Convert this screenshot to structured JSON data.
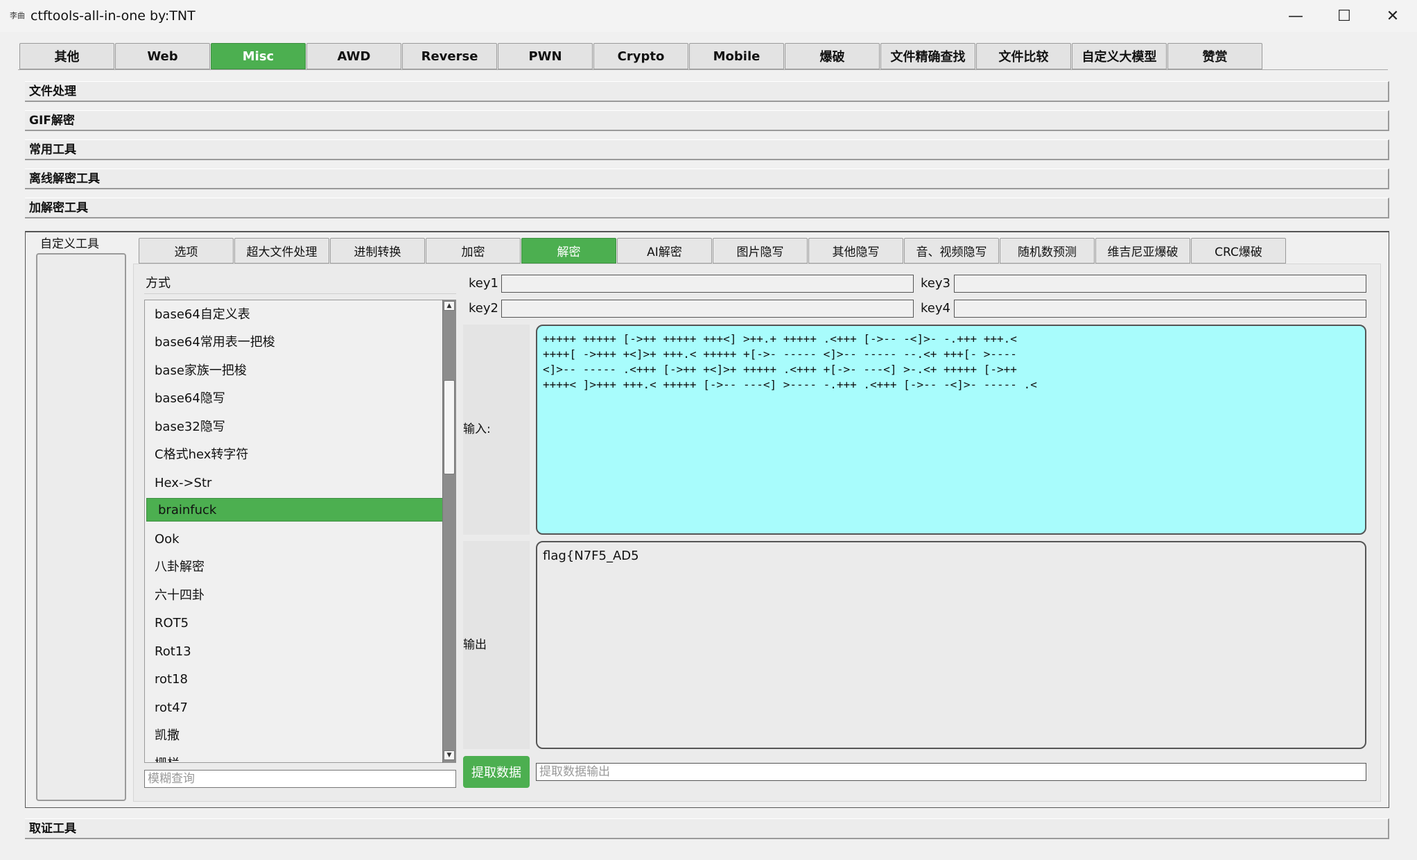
{
  "window": {
    "app_icon_text": "李曲",
    "title": "ctftools-all-in-one   by:TNT",
    "minimize": "—",
    "maximize": "☐",
    "close": "✕"
  },
  "top_tabs": [
    {
      "label": "其他",
      "active": false
    },
    {
      "label": "Web",
      "active": false
    },
    {
      "label": "Misc",
      "active": true
    },
    {
      "label": "AWD",
      "active": false
    },
    {
      "label": "Reverse",
      "active": false
    },
    {
      "label": "PWN",
      "active": false
    },
    {
      "label": "Crypto",
      "active": false
    },
    {
      "label": "Mobile",
      "active": false
    },
    {
      "label": "爆破",
      "active": false
    },
    {
      "label": "文件精确查找",
      "active": false
    },
    {
      "label": "文件比较",
      "active": false
    },
    {
      "label": "自定义大模型",
      "active": false
    },
    {
      "label": "赞赏",
      "active": false
    }
  ],
  "sections": [
    "文件处理",
    "GIF解密",
    "常用工具",
    "离线解密工具",
    "加解密工具"
  ],
  "bottom_section": "取证工具",
  "custom_tools_title": "自定义工具",
  "inner_tabs": [
    {
      "label": "选项",
      "active": false
    },
    {
      "label": "超大文件处理",
      "active": false
    },
    {
      "label": "进制转换",
      "active": false
    },
    {
      "label": "加密",
      "active": false
    },
    {
      "label": "解密",
      "active": true
    },
    {
      "label": "AI解密",
      "active": false
    },
    {
      "label": "图片隐写",
      "active": false
    },
    {
      "label": "其他隐写",
      "active": false
    },
    {
      "label": "音、视频隐写",
      "active": false
    },
    {
      "label": "随机数预测",
      "active": false
    },
    {
      "label": "维吉尼亚爆破",
      "active": false
    },
    {
      "label": "CRC爆破",
      "active": false
    }
  ],
  "method": {
    "label": "方式",
    "items": [
      "base64自定义表",
      "base64常用表一把梭",
      "base家族一把梭",
      "base64隐写",
      "base32隐写",
      "C格式hex转字符",
      "Hex->Str",
      "brainfuck",
      "Ook",
      "八卦解密",
      "六十四卦",
      "ROT5",
      "Rot13",
      "rot18",
      "rot47",
      "凯撒",
      "栅栏"
    ],
    "selected_index": 7,
    "search_placeholder": "模糊查询",
    "scroll_up": "▲",
    "scroll_down": "▼"
  },
  "keys": {
    "key1_label": "key1",
    "key1_value": "",
    "key2_label": "key2",
    "key2_value": "",
    "key3_label": "key3",
    "key3_value": "",
    "key4_label": "key4",
    "key4_value": ""
  },
  "input": {
    "label": "输入:",
    "value": "+++++ +++++ [->++ +++++ +++<] >++.+ +++++ .<+++ [->-- -<]>- -.+++ +++.<\n++++[ ->+++ +<]>+ +++.< +++++ +[->- ----- <]>-- ----- --.<+ +++[- >----\n<]>-- ----- .<+++ [->++ +<]>+ +++++ .<+++ +[->- ---<] >-.<+ +++++ [->++\n++++< ]>+++ +++.< +++++ [->-- ---<] >---- -.+++ .<+++ [->-- -<]>- ----- .<"
  },
  "output": {
    "label": "输出",
    "value": "flag{N7F5_AD5"
  },
  "extract": {
    "button": "提取数据",
    "placeholder": "提取数据输出"
  },
  "colors": {
    "accent": "#4caf50",
    "input_bg": "#a8fcfc"
  }
}
